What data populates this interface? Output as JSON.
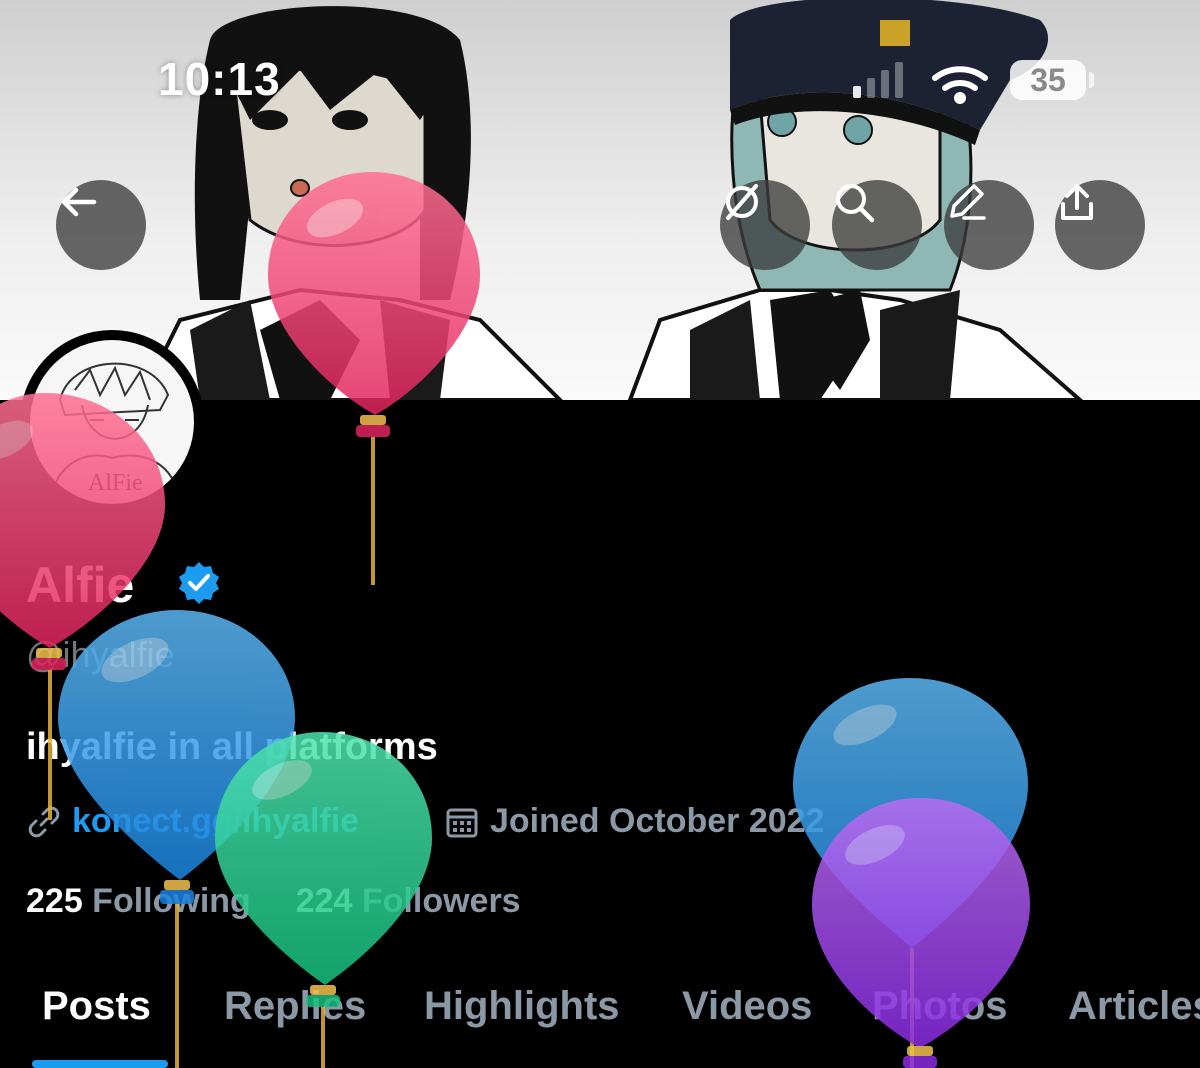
{
  "status_bar": {
    "time": "10:13",
    "battery": "35"
  },
  "header_actions": [
    {
      "icon": "back-arrow-icon",
      "label": "Back"
    },
    {
      "icon": "grok-icon",
      "label": "Grok"
    },
    {
      "icon": "search-icon",
      "label": "Search"
    },
    {
      "icon": "edit-icon",
      "label": "Edit"
    },
    {
      "icon": "share-icon",
      "label": "Share"
    }
  ],
  "profile": {
    "name": "Alfie",
    "verified": true,
    "handle": "@ihyalfie",
    "bio": "ihyalfie in all platforms",
    "link": "konect.gg/ihyalfie",
    "joined": "Joined October 2022",
    "following_count": "225",
    "following_label": " Following",
    "followers_count": "224",
    "followers_label": " Followers",
    "avatar_text": "AlFie"
  },
  "tabs": [
    {
      "label": "Posts",
      "active": true
    },
    {
      "label": "Replies",
      "active": false
    },
    {
      "label": "Highlights",
      "active": false
    },
    {
      "label": "Videos",
      "active": false
    },
    {
      "label": "Photos",
      "active": false
    },
    {
      "label": "Articles",
      "active": false
    }
  ],
  "colors": {
    "accent": "#1d9bf0",
    "background": "#000000",
    "muted": "#8b98a5",
    "verified": "#1d9bf0"
  }
}
